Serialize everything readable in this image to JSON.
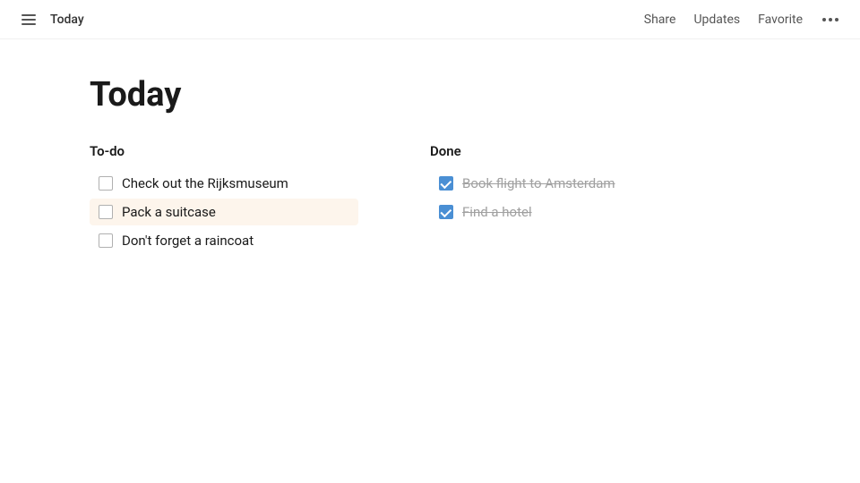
{
  "topbar": {
    "title": "Today",
    "actions": {
      "share": "Share",
      "updates": "Updates",
      "favorite": "Favorite"
    }
  },
  "page": {
    "title": "Today",
    "todo_section": {
      "title": "To-do",
      "items": [
        {
          "id": 1,
          "text": "Check out the Rijksmuseum",
          "done": false,
          "highlighted": false
        },
        {
          "id": 2,
          "text": "Pack a suitcase",
          "done": false,
          "highlighted": true
        },
        {
          "id": 3,
          "text": "Don't forget a raincoat",
          "done": false,
          "highlighted": false
        }
      ]
    },
    "done_section": {
      "title": "Done",
      "items": [
        {
          "id": 4,
          "text": "Book flight to Amsterdam",
          "done": true
        },
        {
          "id": 5,
          "text": "Find a hotel",
          "done": true
        }
      ]
    }
  }
}
